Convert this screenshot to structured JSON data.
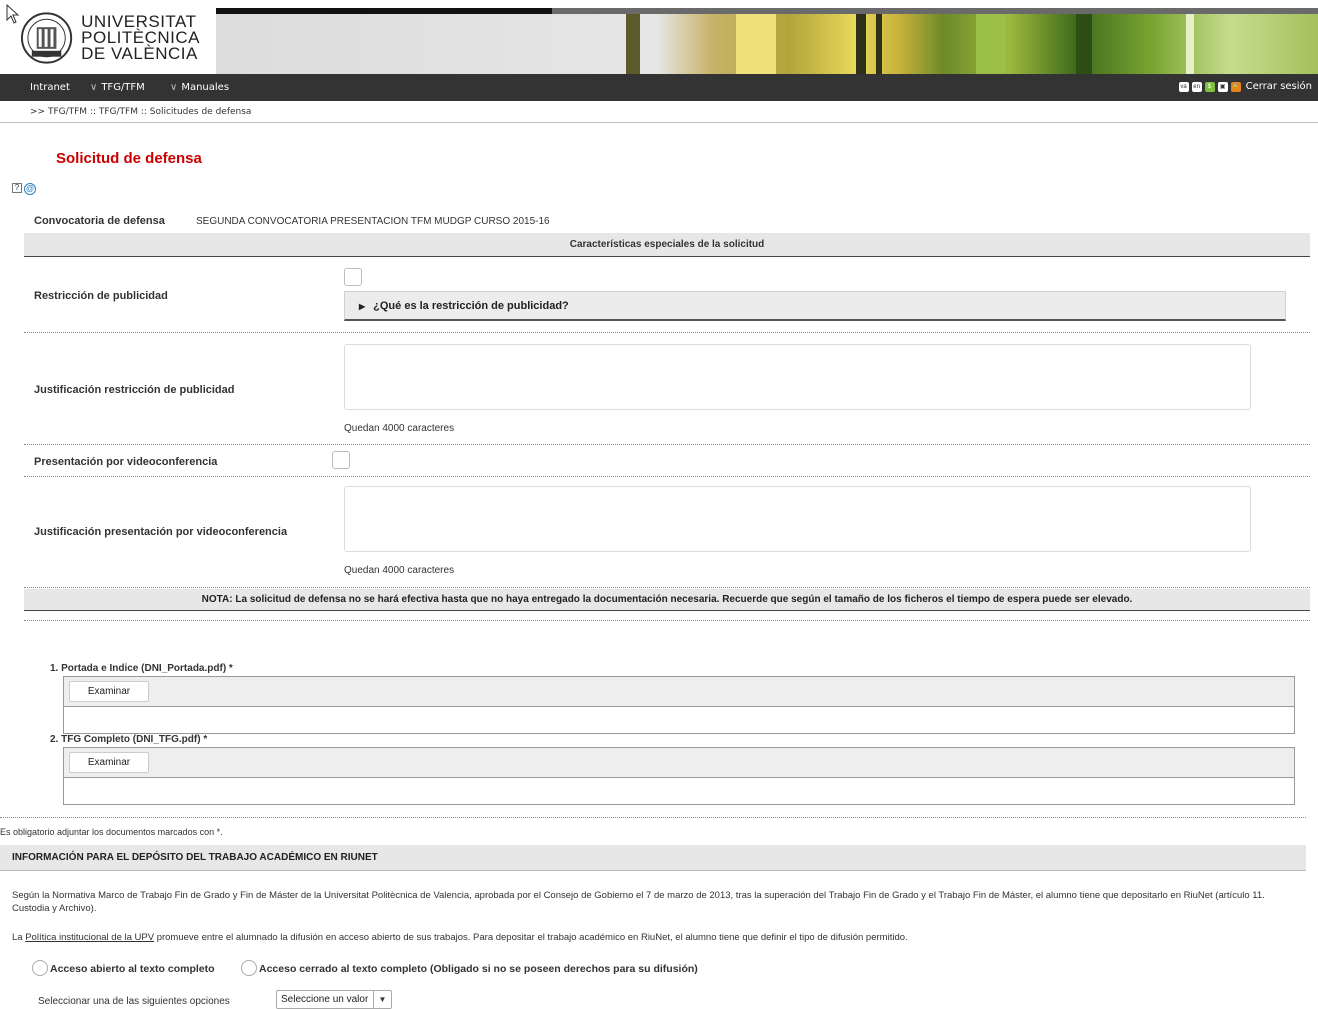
{
  "header": {
    "logo_lines": [
      "UNIVERSITAT",
      "POLITÈCNICA",
      "DE VALÈNCIA"
    ]
  },
  "nav": {
    "items": [
      "Intranet",
      "TFG/TFM",
      "Manuales"
    ],
    "mini_icons": [
      "va",
      "en",
      "$",
      "▣",
      "🔒"
    ],
    "logout": "Cerrar sesión"
  },
  "breadcrumb": ">> TFG/TFM :: TFG/TFM :: Solicitudes de defensa",
  "page_title": "Solicitud de defensa",
  "form": {
    "convocatoria_label": "Convocatoria de defensa",
    "convocatoria_value": "SEGUNDA CONVOCATORIA PRESENTACION TFM MUDGP CURSO 2015-16",
    "special_header": "Características especiales de la solicitud",
    "restriccion_label": "Restricción de publicidad",
    "restriccion_collapse": "¿Qué es la restricción de publicidad?",
    "justif_restriccion_label": "Justificación restricción de publicidad",
    "remaining_1": "Quedan 4000 caracteres",
    "video_label": "Presentación por videoconferencia",
    "justif_video_label": "Justificación presentación por videoconferencia",
    "remaining_2": "Quedan 4000 caracteres",
    "note": "NOTA: La solicitud de defensa no se hará efectiva hasta que no haya entregado la documentación necesaria. Recuerde que según el tamaño de los ficheros el tiempo de espera puede ser elevado."
  },
  "files": [
    {
      "label": "1. Portada e Indice (DNI_Portada.pdf)  *",
      "button": "Examinar"
    },
    {
      "label": "2. TFG Completo (DNI_TFG.pdf)  *",
      "button": "Examinar"
    }
  ],
  "mandatory_note": "Es obligatorio adjuntar los documentos marcados con *.",
  "riunet": {
    "header": "INFORMACIÓN PARA EL DEPÓSITO DEL TRABAJO ACADÉMICO EN RIUNET",
    "para1": "Según la Normativa Marco de Trabajo Fin de Grado y Fin de Máster de la Universitat Politècnica de Valencia, aprobada por el Consejo de Gobierno el 7 de marzo de 2013, tras la superación del Trabajo Fin de Grado y el Trabajo Fin de Máster, el alumno tiene que depositarlo en RiuNet (artículo 11. Custodia y Archivo).",
    "para2_prefix": "La ",
    "para2_link": "Política institucional de la UPV",
    "para2_suffix": " promueve entre el alumnado la difusión en acceso abierto de sus trabajos. Para depositar el trabajo académico en RiuNet, el alumno tiene que definir el tipo de difusión permitido.",
    "radio_open": "Acceso abierto al texto completo",
    "radio_closed": "Acceso cerrado al texto completo (Obligado si no se poseen derechos para su difusión)",
    "select_label": "Seleccionar una de las siguientes opciones",
    "select_value": "Seleccione un valor"
  }
}
